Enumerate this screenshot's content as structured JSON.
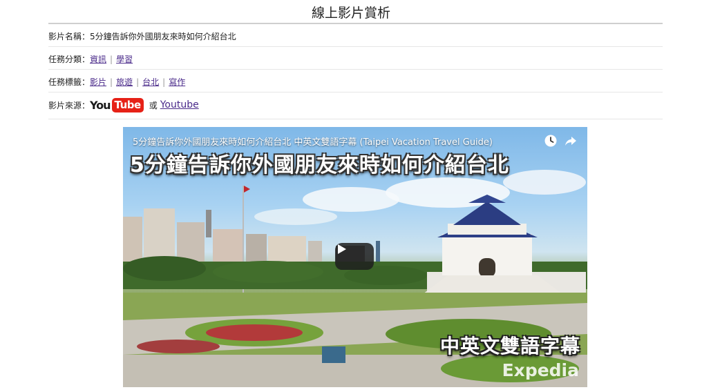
{
  "page": {
    "title": "線上影片賞析"
  },
  "info": {
    "name_label": "影片名稱：",
    "name_value": "5分鐘告訴你外國朋友來時如何介紹台北",
    "category_label": "任務分類：",
    "categories": [
      "資訊",
      "學習"
    ],
    "tags_label": "任務標籤：",
    "tags": [
      "影片",
      "旅遊",
      "台北",
      "寫作"
    ],
    "source_label": "影片來源：",
    "source_logo": {
      "you": "You",
      "tube": "Tube"
    },
    "source_or": "或",
    "source_link": "Youtube"
  },
  "video": {
    "title": "5分鐘告訴你外國朋友來時如何介紹台北 中英文雙語字幕 (Taipei Vacation Travel Guide)",
    "headline": "5分鐘告訴你外國朋友來時如何介紹台北",
    "subtitle_badge": "中英文雙語字幕",
    "brand": "Expedia",
    "icons": [
      "clock-icon",
      "share-icon",
      "play-icon"
    ],
    "colors": {
      "youtube_red": "#e62117",
      "link": "#4a2a8a"
    }
  }
}
